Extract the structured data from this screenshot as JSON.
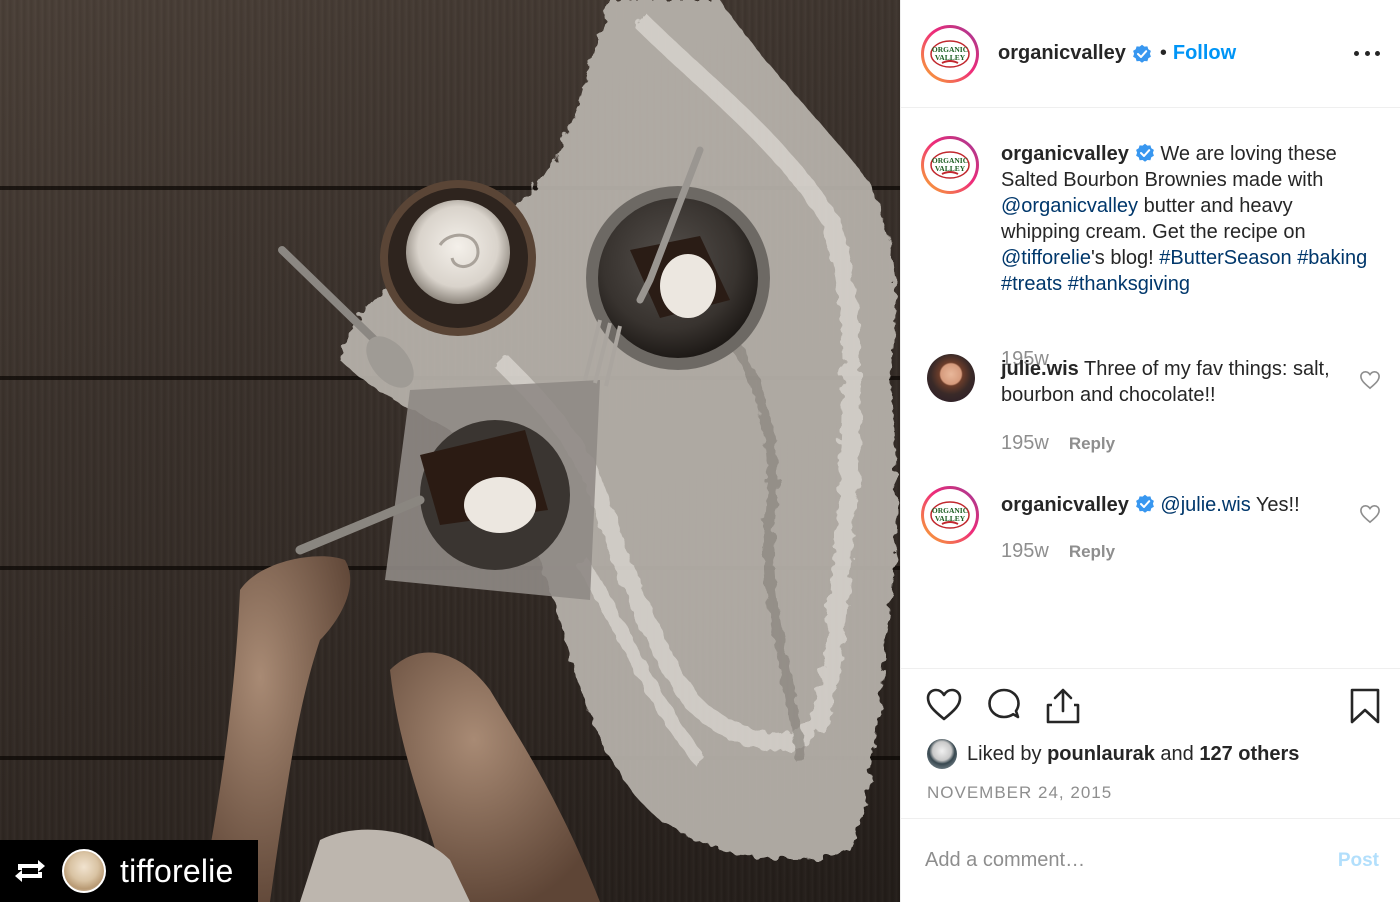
{
  "photo": {
    "alt_scene": "brownies",
    "repost": {
      "icon": "repost-icon",
      "username": "tifforelie"
    }
  },
  "header": {
    "username": "organicvalley",
    "verified_icon": "verified-badge-icon",
    "separator": "•",
    "follow_label": "Follow",
    "more_icon": "more-options-icon"
  },
  "logo": {
    "line1": "ORGANIC",
    "line2": "VALLEY"
  },
  "caption": {
    "username": "organicvalley",
    "text_1": " We are loving these Salted Bourbon Brownies made with ",
    "mention_1": "@organicvalley",
    "text_2": " butter and heavy whipping cream. Get the recipe on ",
    "mention_2": "@tifforelie",
    "text_3": "'s blog! ",
    "tag_1": "#ButterSeason",
    "tag_2": "#baking",
    "tag_3": "#treats",
    "tag_4": "#thanksgiving",
    "time": "195w"
  },
  "comments": [
    {
      "username": "julie.wis",
      "text": " Three of my fav things: salt, bourbon and chocolate!!",
      "time": "195w",
      "reply_label": "Reply"
    },
    {
      "username": "organicvalley",
      "mention": "@julie.wis",
      "text": " Yes!!",
      "time": "195w",
      "reply_label": "Reply"
    }
  ],
  "actions": {
    "like_icon": "heart-icon",
    "comment_icon": "comment-icon",
    "share_icon": "share-icon",
    "save_icon": "bookmark-icon"
  },
  "likes": {
    "prefix": "Liked by ",
    "first_user": "pounlaurak",
    "middle": " and ",
    "others": "127 others"
  },
  "date": "NOVEMBER 24, 2015",
  "add_comment": {
    "placeholder": "Add a comment…",
    "post_label": "Post"
  },
  "colors": {
    "link": "#00376b",
    "follow": "#0095f6",
    "verified": "#3897f0",
    "muted": "#8e8e8e",
    "post_disabled": "#b2dffc"
  }
}
